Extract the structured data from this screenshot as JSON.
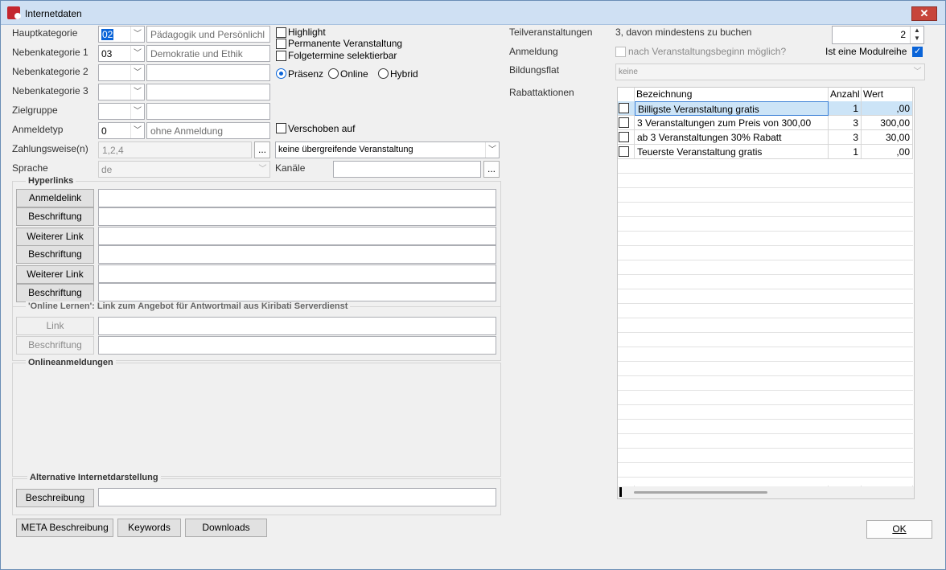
{
  "window": {
    "title": "Internetdaten",
    "close": "✕"
  },
  "left": {
    "hauptkategorie": {
      "label": "Hauptkategorie",
      "code": "02",
      "text": "Pädagogik und Persönlichl"
    },
    "nebenkategorie1": {
      "label": "Nebenkategorie 1",
      "code": "03",
      "text": "Demokratie und Ethik"
    },
    "nebenkategorie2": {
      "label": "Nebenkategorie 2"
    },
    "nebenkategorie3": {
      "label": "Nebenkategorie 3"
    },
    "zielgruppe": {
      "label": "Zielgruppe"
    },
    "anmeldetyp": {
      "label": "Anmeldetyp",
      "code": "0",
      "text": "ohne Anmeldung"
    },
    "zahlungsweise": {
      "label": "Zahlungsweise(n)",
      "value": "1,2,4",
      "button": "..."
    },
    "sprache": {
      "label": "Sprache",
      "value": "de"
    },
    "kanaele": {
      "label": "Kanäle",
      "button": "..."
    },
    "uebergreifend": {
      "value": "keine übergreifende Veranstaltung"
    }
  },
  "options": {
    "highlight": "Highlight",
    "permanent": "Permanente Veranstaltung",
    "folgetermine": "Folgetermine selektierbar",
    "praesenz": "Präsenz",
    "online": "Online",
    "hybrid": "Hybrid",
    "verschoben": "Verschoben auf"
  },
  "hyperlinks": {
    "title": "Hyperlinks",
    "buttons": [
      "Anmeldelink",
      "Beschriftung",
      "Weiterer Link",
      "Beschriftung",
      "Weiterer Link",
      "Beschriftung"
    ]
  },
  "online_lernen": {
    "title": "'Online Lernen': Link zum Angebot für Antwortmail aus Kiribati Serverdienst",
    "buttons": [
      "Link",
      "Beschriftung"
    ]
  },
  "onlineanmeldungen": {
    "title": "Onlineanmeldungen"
  },
  "alternative": {
    "title": "Alternative Internetdarstellung",
    "button": "Beschreibung"
  },
  "bottom_buttons": [
    "META Beschreibung",
    "Keywords",
    "Downloads"
  ],
  "right": {
    "teilveranstaltungen": {
      "label": "Teilveranstaltungen",
      "text": "3, davon mindestens zu buchen",
      "value": "2"
    },
    "anmeldung": {
      "label": "Anmeldung",
      "checkbox": "nach Veranstaltungsbeginn möglich?",
      "modulreihe": "Ist eine Modulreihe"
    },
    "bildungsflat": {
      "label": "Bildungsflat",
      "value": "keine"
    },
    "rabattaktionen": {
      "label": "Rabattaktionen"
    }
  },
  "grid": {
    "headers": [
      "Bezeichnung",
      "Anzahl",
      "Wert"
    ],
    "rows": [
      {
        "name": "Billigste Veranstaltung gratis",
        "anzahl": "1",
        "wert": ",00"
      },
      {
        "name": "3 Veranstaltungen zum Preis von 300,00",
        "anzahl": "3",
        "wert": "300,00"
      },
      {
        "name": "ab 3 Veranstaltungen 30% Rabatt",
        "anzahl": "3",
        "wert": "30,00"
      },
      {
        "name": "Teuerste Veranstaltung gratis",
        "anzahl": "1",
        "wert": ",00"
      }
    ]
  },
  "ok_button": "OK",
  "colors": {
    "accent": "#0a64d8",
    "titlebar": "#cfe0f3",
    "close": "#c7453b",
    "selected_row": "#cce4f7"
  }
}
